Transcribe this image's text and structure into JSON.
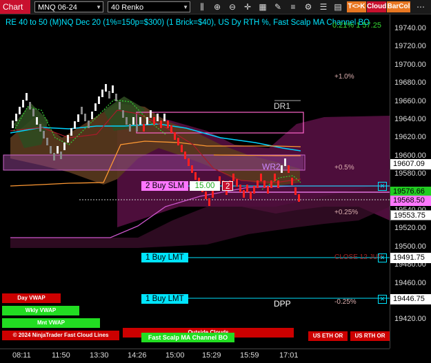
{
  "toolbar": {
    "chart_label": "Chart",
    "instrument": "MNQ 06-24",
    "bar_type": "40 Renko",
    "tk_label": "T<>K",
    "cloud_label": "Cloud",
    "barcol_label": "BarCol"
  },
  "title": "RE 40 to 50 (M)NQ Dec 20 (1%=150p=$300) (1 Brick=$40), US Dy RTH %, Fast Scalp MA Channel BO",
  "top_right_value": "0.21% 1 57.25",
  "price_axis": [
    "19740.00",
    "19720.00",
    "19700.00",
    "19680.00",
    "19660.00",
    "19640.00",
    "19620.00",
    "19600.00",
    "19580.00",
    "19560.00",
    "19540.00",
    "19520.00",
    "19500.00",
    "19480.00",
    "19460.00",
    "19440.00",
    "19420.00"
  ],
  "price_boxes": {
    "cyan_top": "19607.09",
    "green": "19576.66",
    "pink": "19568.50",
    "last": "19553.75",
    "order1": "19491.75",
    "order2": "19446.75"
  },
  "time_axis": [
    "08:11",
    "11:50",
    "13:30",
    "14:26",
    "15:00",
    "15:29",
    "15:59",
    "17:01"
  ],
  "levels": {
    "pct_1": "+1.0%",
    "pct_05": "+0.5%",
    "pct_025": "+0.25%",
    "pct_neg025": "-0.25%",
    "dr1": "DR1",
    "wr2": "WR2",
    "dpp": "DPP",
    "close_label": "CLOSE 12 JUN"
  },
  "orders": {
    "buy_slm_label": "2 Buy SLM",
    "buy_slm_price": "15.00",
    "buy_slm_qty": "2",
    "buy_lmt_1": "1 Buy LMT",
    "buy_lmt_2": "1 Buy LMT",
    "close_x": "✕"
  },
  "chips": {
    "day_vwap": "Day VWAP",
    "wkly_vwap": "Wkly VWAP",
    "mnt_vwap": "Mnt VWAP",
    "outside_clouds": "Outside Clouds",
    "fast_scalp": "Fast Scalp MA Channel BO",
    "us_eth_or": "US ETH OR",
    "us_rth_or": "US RTH OR",
    "copyright": "© 2024 NinjaTrader Fast Cloud Lines"
  },
  "colors": {
    "accent_red": "#c8102e",
    "cyan": "#00e5ff",
    "magenta": "#ff66ff",
    "green_chip": "#22dd22",
    "red_chip": "#cc0000"
  }
}
